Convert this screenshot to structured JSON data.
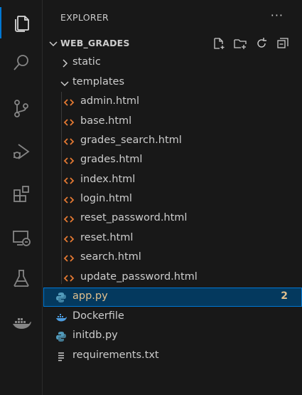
{
  "activity_bar": {
    "items": [
      {
        "icon": "explorer-icon",
        "active": true
      },
      {
        "icon": "search-icon",
        "active": false
      },
      {
        "icon": "source-control-icon",
        "active": false
      },
      {
        "icon": "run-debug-icon",
        "active": false
      },
      {
        "icon": "extensions-icon",
        "active": false
      },
      {
        "icon": "remote-explorer-icon",
        "active": false
      },
      {
        "icon": "testing-icon",
        "active": false
      },
      {
        "icon": "docker-icon",
        "active": false
      }
    ]
  },
  "sidebar": {
    "title": "EXPLORER",
    "more_label": "···",
    "section": {
      "title": "WEB_GRADES",
      "actions": [
        "new-file-icon",
        "new-folder-icon",
        "refresh-icon",
        "collapse-all-icon"
      ]
    },
    "tree": [
      {
        "label": "static",
        "kind": "folder-collapsed"
      },
      {
        "label": "templates",
        "kind": "folder-expanded"
      },
      {
        "label": "admin.html",
        "kind": "html"
      },
      {
        "label": "base.html",
        "kind": "html"
      },
      {
        "label": "grades_search.html",
        "kind": "html"
      },
      {
        "label": "grades.html",
        "kind": "html"
      },
      {
        "label": "index.html",
        "kind": "html"
      },
      {
        "label": "login.html",
        "kind": "html"
      },
      {
        "label": "reset_password.html",
        "kind": "html"
      },
      {
        "label": "reset.html",
        "kind": "html"
      },
      {
        "label": "search.html",
        "kind": "html"
      },
      {
        "label": "update_password.html",
        "kind": "html"
      },
      {
        "label": "app.py",
        "kind": "python",
        "selected": true,
        "badge": "2"
      },
      {
        "label": "Dockerfile",
        "kind": "docker"
      },
      {
        "label": "initdb.py",
        "kind": "python"
      },
      {
        "label": "requirements.txt",
        "kind": "text"
      }
    ]
  },
  "colors": {
    "background": "#181818",
    "accent": "#0078d4",
    "selection": "#04395e",
    "html_icon": "#e37933",
    "python_icon": "#519aba",
    "docker_icon": "#4d9de0",
    "selected_text": "#e2c08d"
  }
}
